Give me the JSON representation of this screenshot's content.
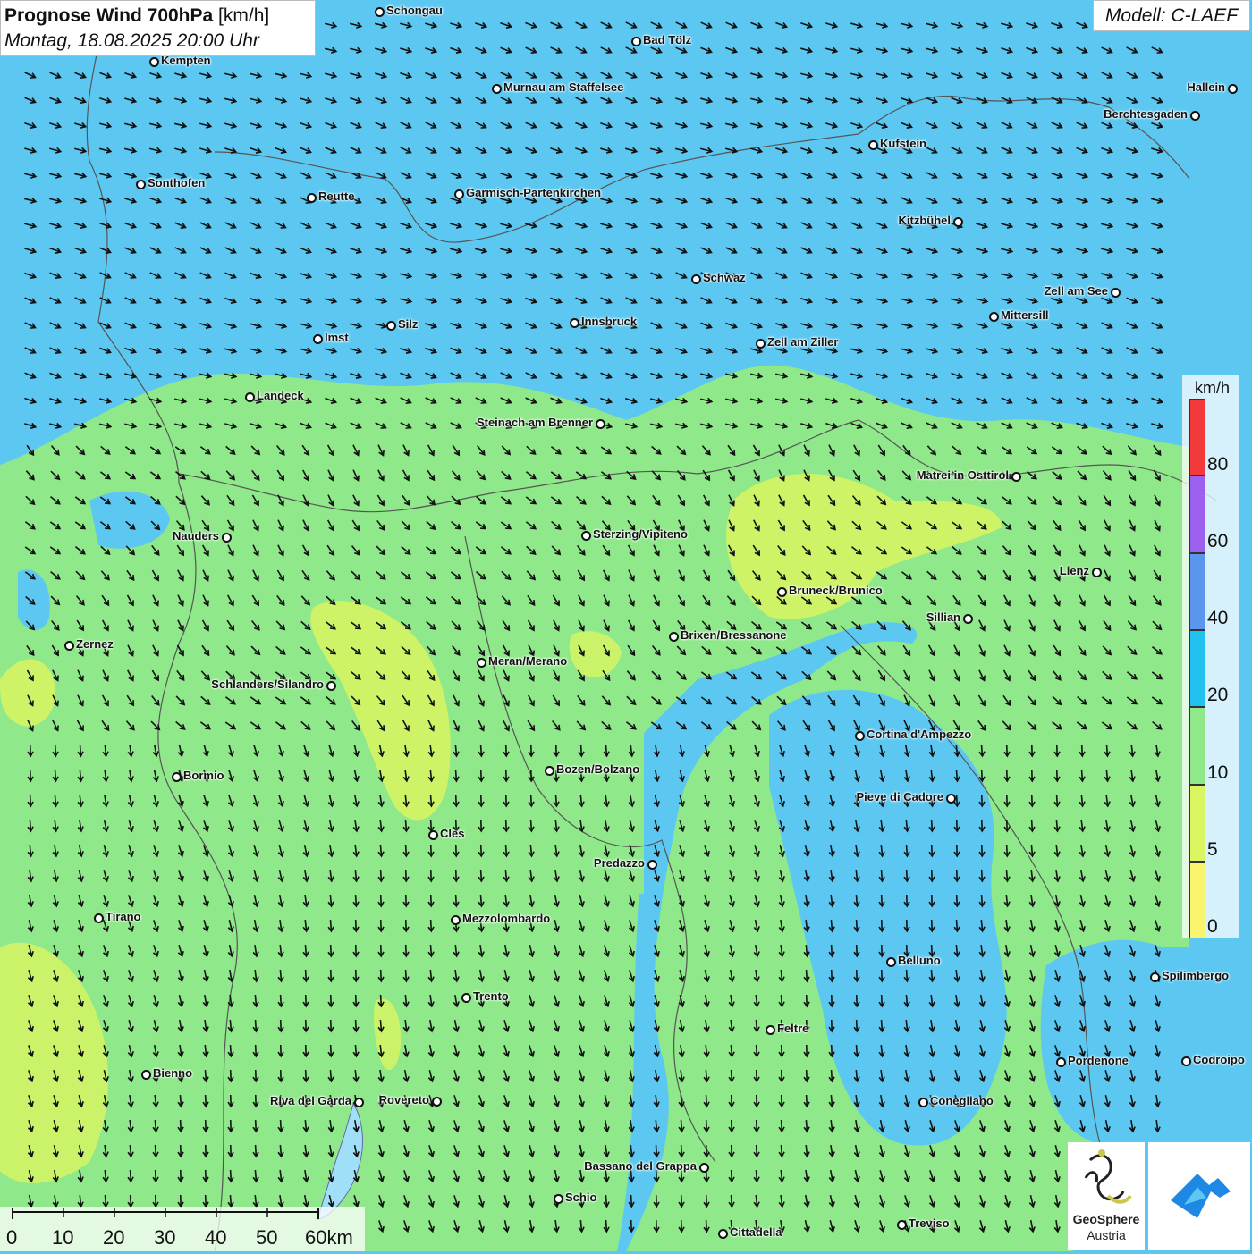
{
  "header": {
    "title_bold": "Prognose Wind 700hPa",
    "title_unit": "[km/h]",
    "subtitle": "Montag, 18.08.2025 20:00 Uhr"
  },
  "model": {
    "label": "Modell: C-LAEF"
  },
  "legend": {
    "unit": "km/h",
    "labels": [
      "80",
      "60",
      "40",
      "20",
      "10",
      "5",
      "0"
    ],
    "colors": [
      "#f23a3a",
      "#9b60ee",
      "#5a96ee",
      "#22c0ee",
      "#8fe88a",
      "#d9f560",
      "#f9f36e"
    ]
  },
  "scale_bar": {
    "labels": [
      "0",
      "10",
      "20",
      "30",
      "40",
      "50",
      "60km"
    ]
  },
  "cities": [
    {
      "name": "Schongau"
    },
    {
      "name": "Bad Tölz"
    },
    {
      "name": "Kempten"
    },
    {
      "name": "Murnau am Staffelsee"
    },
    {
      "name": "Hallein"
    },
    {
      "name": "Berchtesgaden"
    },
    {
      "name": "Kufstein"
    },
    {
      "name": "Sonthofen"
    },
    {
      "name": "Reutte"
    },
    {
      "name": "Garmisch-Partenkirchen"
    },
    {
      "name": "Kitzbühel"
    },
    {
      "name": "Schwaz"
    },
    {
      "name": "Zell am See"
    },
    {
      "name": "Mittersill"
    },
    {
      "name": "Innsbruck"
    },
    {
      "name": "Imst"
    },
    {
      "name": "Silz"
    },
    {
      "name": "Zell am Ziller"
    },
    {
      "name": "Landeck"
    },
    {
      "name": "Steinach am Brenner"
    },
    {
      "name": "Matrei in Osttirol"
    },
    {
      "name": "Nauders"
    },
    {
      "name": "Sterzing/Vipiteno"
    },
    {
      "name": "Lienz"
    },
    {
      "name": "Bruneck/Brunico"
    },
    {
      "name": "Sillian"
    },
    {
      "name": "Zernez"
    },
    {
      "name": "Brixen/Bressanone"
    },
    {
      "name": "Meran/Merano"
    },
    {
      "name": "Schlanders/Silandro"
    },
    {
      "name": "Cortina d'Ampezzo"
    },
    {
      "name": "Bozen/Bolzano"
    },
    {
      "name": "Bormio"
    },
    {
      "name": "Pieve di Cadore"
    },
    {
      "name": "Cles"
    },
    {
      "name": "Predazzo"
    },
    {
      "name": "Tirano"
    },
    {
      "name": "Mezzolombardo"
    },
    {
      "name": "Belluno"
    },
    {
      "name": "Spilimbergo"
    },
    {
      "name": "Trento"
    },
    {
      "name": "Feltre"
    },
    {
      "name": "Pordenone"
    },
    {
      "name": "Codroipo"
    },
    {
      "name": "Bienno"
    },
    {
      "name": "Riva del Garda"
    },
    {
      "name": "Rovereto"
    },
    {
      "name": "Conegliano"
    },
    {
      "name": "Bassano del Grappa"
    },
    {
      "name": "Schio"
    },
    {
      "name": "Cittadella"
    },
    {
      "name": "Treviso"
    }
  ],
  "logos": {
    "geosphere_line1": "GeoSphere",
    "geosphere_line2": "Austria"
  }
}
